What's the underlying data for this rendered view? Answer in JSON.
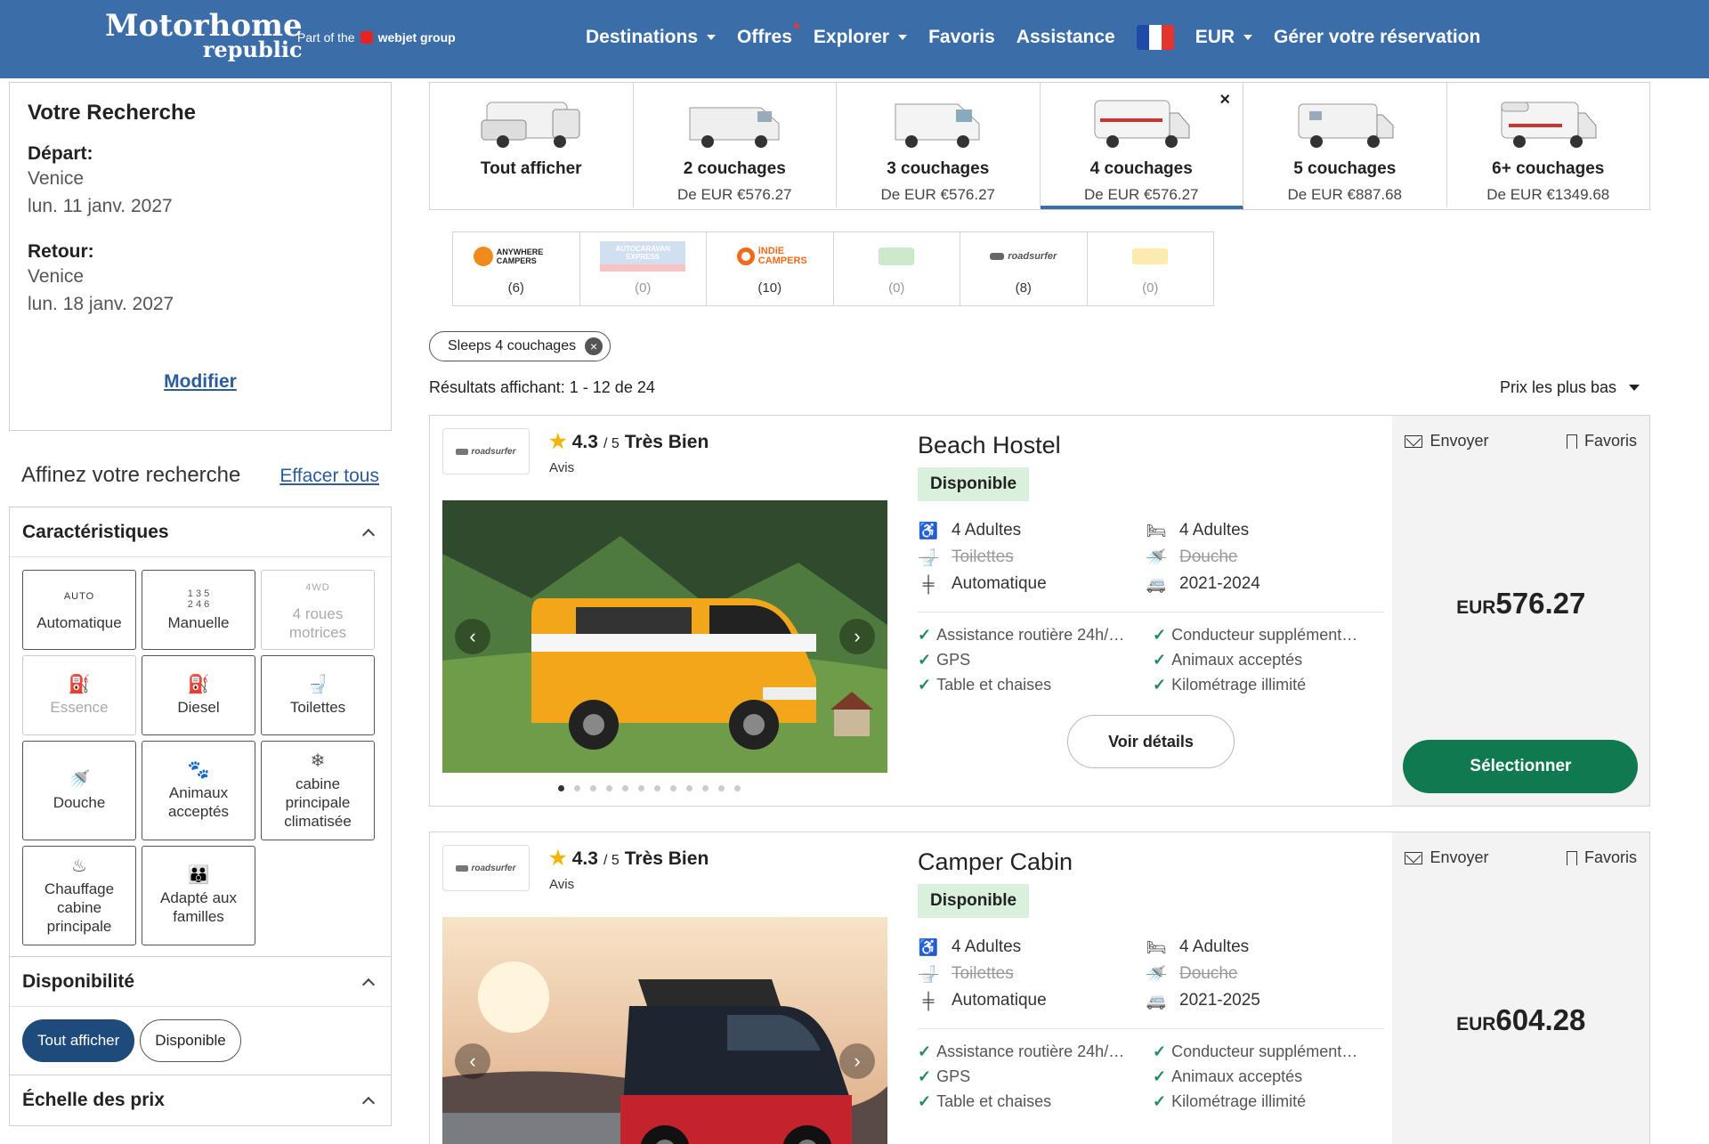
{
  "header": {
    "logo_line1": "Motorhome",
    "logo_line2": "republic",
    "partof": "Part of the",
    "group": "webjet group",
    "nav": {
      "destinations": "Destinations",
      "offres": "Offres",
      "explorer": "Explorer",
      "favoris": "Favoris",
      "assistance": "Assistance",
      "currency": "EUR",
      "manage": "Gérer votre réservation"
    },
    "colors": {
      "bar": "#3b6ea9",
      "flag_blue": "#1f4aa8",
      "flag_white": "#ffffff",
      "flag_red": "#e3342f"
    }
  },
  "search": {
    "title": "Votre Recherche",
    "depart_label": "Départ:",
    "depart_place": "Venice",
    "depart_date": "lun. 11 janv. 2027",
    "retour_label": "Retour:",
    "retour_place": "Venice",
    "retour_date": "lun. 18 janv. 2027",
    "modify": "Modifier"
  },
  "refine": {
    "title": "Affinez votre recherche",
    "clear": "Effacer tous"
  },
  "characteristics": {
    "title": "Caractéristiques",
    "items": [
      {
        "label": "Automatique",
        "top": "AUTO"
      },
      {
        "label": "Manuelle",
        "top": "1 3 5\n2 4 6"
      },
      {
        "label": "4 roues motrices",
        "top": "4WD"
      },
      {
        "label": "Essence"
      },
      {
        "label": "Diesel"
      },
      {
        "label": "Toilettes"
      },
      {
        "label": "Douche"
      },
      {
        "label": "Animaux acceptés"
      },
      {
        "label": "cabine principale climatisée"
      },
      {
        "label": "Chauffage cabine principale"
      },
      {
        "label": "Adapté aux familles"
      }
    ]
  },
  "availability": {
    "title": "Disponibilité",
    "all": "Tout afficher",
    "available": "Disponible"
  },
  "price_scale": {
    "title": "Échelle des prix"
  },
  "tabs": [
    {
      "label": "Tout afficher",
      "price": ""
    },
    {
      "label": "2 couchages",
      "price": "De EUR €576.27"
    },
    {
      "label": "3 couchages",
      "price": "De EUR €576.27"
    },
    {
      "label": "4 couchages",
      "price": "De EUR €576.27",
      "close": "×"
    },
    {
      "label": "5 couchages",
      "price": "De EUR €887.68"
    },
    {
      "label": "6+ couchages",
      "price": "De EUR €1349.68"
    }
  ],
  "brands": [
    {
      "name": "ANYWHERE CAMPERS",
      "count": "(6)"
    },
    {
      "name": "AUTOCARAVAN EXPRESS",
      "count": "(0)"
    },
    {
      "name": "iNDiE CAMPERS",
      "count": "(10)"
    },
    {
      "name": "",
      "count": "(0)"
    },
    {
      "name": "roadsurfer",
      "count": "(8)"
    },
    {
      "name": "",
      "count": "(0)"
    }
  ],
  "filter_chip": "Sleeps 4 couchages",
  "results": {
    "label": "Résultats affichant:",
    "range": "1 - 12 de 24",
    "sort": "Prix les plus bas"
  },
  "cards": [
    {
      "logo": "roadsurfer",
      "rating": "4.3",
      "of": "/ 5",
      "rating_text": "Très Bien",
      "avis": "Avis",
      "title": "Beach Hostel",
      "badge": "Disponible",
      "specs": {
        "seats": "4 Adultes",
        "beds": "4 Adultes",
        "toilet": "Toilettes",
        "shower": "Douche",
        "trans": "Automatique",
        "years": "2021-2024"
      },
      "features": [
        "Assistance routière 24h/…",
        "Conducteur supplément…",
        "GPS",
        "Animaux acceptés",
        "Table et chaises",
        "Kilométrage illimité"
      ],
      "details": "Voir détails",
      "share": "Envoyer",
      "fav": "Favoris",
      "currency": "EUR",
      "price": "576.27",
      "select": "Sélectionner"
    },
    {
      "logo": "roadsurfer",
      "rating": "4.3",
      "of": "/ 5",
      "rating_text": "Très Bien",
      "avis": "Avis",
      "title": "Camper Cabin",
      "badge": "Disponible",
      "specs": {
        "seats": "4 Adultes",
        "beds": "4 Adultes",
        "toilet": "Toilettes",
        "shower": "Douche",
        "trans": "Automatique",
        "years": "2021-2025"
      },
      "features": [
        "Assistance routière 24h/…",
        "Conducteur supplément…",
        "GPS",
        "Animaux acceptés",
        "Table et chaises",
        "Kilométrage illimité"
      ],
      "share": "Envoyer",
      "fav": "Favoris",
      "currency": "EUR",
      "price": "604.28"
    }
  ]
}
